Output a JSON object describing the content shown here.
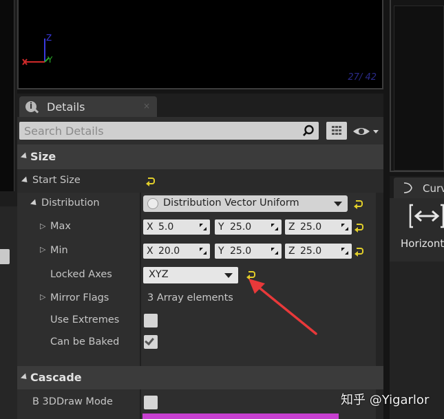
{
  "viewport": {
    "frame_counter": "27/ 42",
    "axis_labels": {
      "z": "Z",
      "y": "Y"
    }
  },
  "details_tab": {
    "label": "Details",
    "close": "×"
  },
  "search": {
    "placeholder": "Search Details"
  },
  "sections": {
    "size": "Size",
    "cascade": "Cascade"
  },
  "properties": {
    "start_size": "Start Size",
    "distribution": "Distribution",
    "distribution_value": "Distribution Vector Uniform",
    "max": "Max",
    "max_values": [
      {
        "axis": "X",
        "value": "5.0"
      },
      {
        "axis": "Y",
        "value": "25.0"
      },
      {
        "axis": "Z",
        "value": "25.0"
      }
    ],
    "min": "Min",
    "min_values": [
      {
        "axis": "X",
        "value": "20.0"
      },
      {
        "axis": "Y",
        "value": "25.0"
      },
      {
        "axis": "Z",
        "value": "25.0"
      }
    ],
    "locked_axes": "Locked Axes",
    "locked_axes_value": "XYZ",
    "mirror_flags": "Mirror Flags",
    "mirror_flags_value": "3 Array elements",
    "use_extremes": "Use Extremes",
    "use_extremes_checked": false,
    "can_be_baked": "Can be Baked",
    "can_be_baked_checked": true,
    "b3d_draw_mode": "B 3DDraw Mode",
    "b3d_draw_mode_checked": false
  },
  "right_panel": {
    "curve_tab": "Curve",
    "horizontal_label": "Horizonta"
  },
  "watermark": "知乎 @Yigarlor",
  "colors": {
    "reset_arrow": "#e2cf2a",
    "annotation_arrow": "#e8393a",
    "accent_bar": "#c73fd0"
  }
}
